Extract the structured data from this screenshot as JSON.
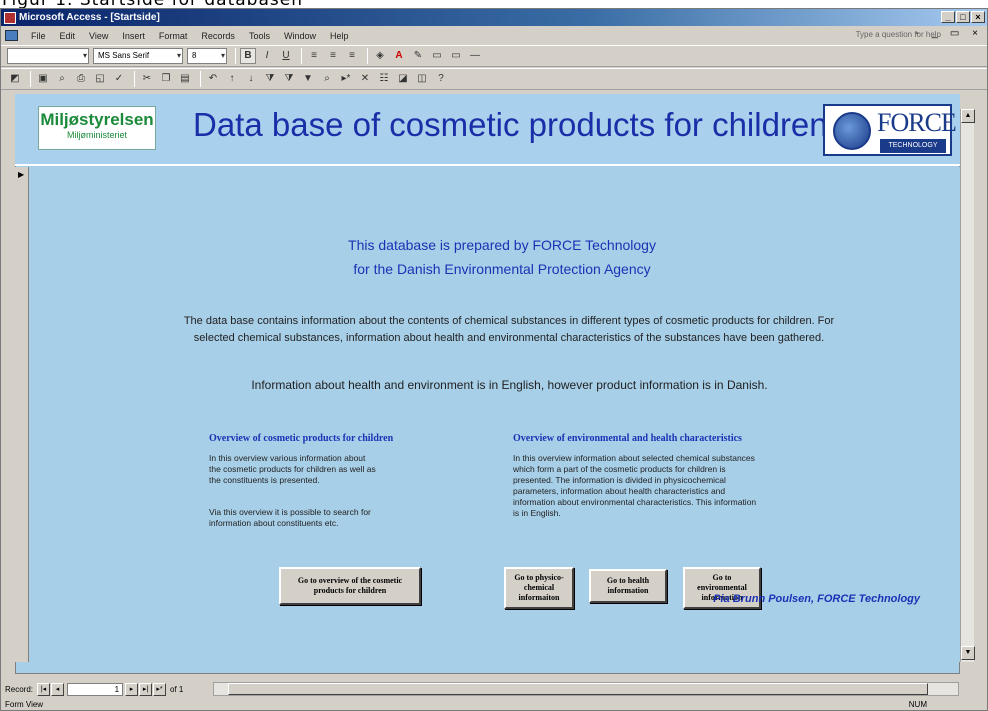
{
  "caption": "Figur 1. Startside for databasen",
  "window": {
    "title": "Microsoft Access - [Startside]",
    "controls": [
      "_",
      "□",
      "×"
    ]
  },
  "menu": {
    "items": [
      "File",
      "Edit",
      "View",
      "Insert",
      "Format",
      "Records",
      "Tools",
      "Window",
      "Help"
    ],
    "help_placeholder": "Type a question for help",
    "right_controls": "- _ ▭ ×"
  },
  "toolbar": {
    "font_name": "MS Sans Serif",
    "font_size": "8",
    "bold_label": "B",
    "italic_label": "I",
    "underline_label": "U"
  },
  "header": {
    "logo_left_line1": "Miljøstyrelsen",
    "logo_left_line2": "Miljøministeriet",
    "title": "Data base of cosmetic products for children",
    "logo_right_name": "FORCE",
    "logo_right_sub": "TECHNOLOGY"
  },
  "content": {
    "prepared_line1": "This database is prepared by FORCE Technology",
    "prepared_line2": "for the Danish Environmental Protection Agency",
    "description": "The data base contains information about the contents of chemical substances in different types of cosmetic products for children. For selected chemical substances, information about health and environmental characteristics of the substances have been gathered.",
    "language_note": "Information about health and environment is in English, however product information is in Danish.",
    "col_left": {
      "title": "Overview of cosmetic products for children",
      "text1": "In this overview various information about the cosmetic products for children as well as the constituents is presented.",
      "text2": "Via this overview it is possible to search for information about constituents etc."
    },
    "col_right": {
      "title": "Overview of environmental and health characteristics",
      "text1": "In this overview information about selected chemical substances which form a part of the cosmetic products for children is presented. The information is divided in physicochemical parameters, information about health characteristics and information about environmental characteristics. This information is in English."
    },
    "buttons": {
      "overview": "Go to overview of the cosmetic products for children",
      "physico": "Go to physico-chemical informaiton",
      "health": "Go to health information",
      "environmental": "Go to environmental information"
    },
    "credit": "Pia Brunn Poulsen, FORCE Technology"
  },
  "navigation": {
    "label": "Record:",
    "current": "1",
    "of_text": "of 1"
  },
  "status": {
    "mode": "Form View",
    "num": "NUM"
  }
}
